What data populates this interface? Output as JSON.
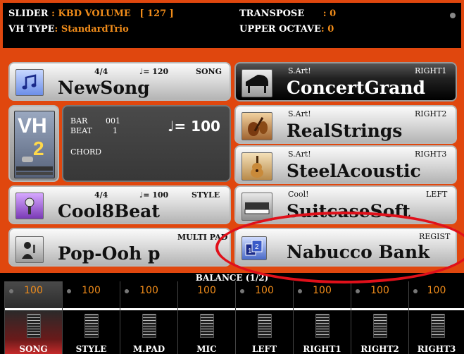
{
  "topbar": {
    "slider_label": "SLIDER",
    "slider_value": ": KBD VOLUME",
    "slider_bracket": "[    127    ]",
    "vh_type_label": "VH TYPE",
    "vh_type_value": ": StandardTrio",
    "transpose_label": "TRANSPOSE",
    "transpose_value": ": 0",
    "upper_octave_label": "UPPER OCTAVE",
    "upper_octave_value": ": 0"
  },
  "song": {
    "time_sig": "4/4",
    "tempo": "♩= 120",
    "type": "SONG",
    "name": "NewSong"
  },
  "vh_icon_text": "VH",
  "bar_beat": {
    "bar_label": "BAR",
    "bar_value": "001",
    "beat_label": "BEAT",
    "beat_value": "1",
    "chord_label": "CHORD",
    "tempo": "♩= 100"
  },
  "style": {
    "time_sig": "4/4",
    "tempo": "♩= 100",
    "type": "STYLE",
    "name": "Cool8Beat"
  },
  "multipad": {
    "type": "MULTI PAD",
    "name": "Pop-Ooh p"
  },
  "right_parts": [
    {
      "category": "S.Art!",
      "part": "RIGHT1",
      "name": "ConcertGrand"
    },
    {
      "category": "S.Art!",
      "part": "RIGHT2",
      "name": "RealStrings"
    },
    {
      "category": "S.Art!",
      "part": "RIGHT3",
      "name": "SteelAcoustic"
    },
    {
      "category": "Cool!",
      "part": "LEFT",
      "name": "SuitcaseSoft"
    }
  ],
  "regist": {
    "type": "REGIST",
    "name": "Nabucco Bank"
  },
  "balance": {
    "title": "BALANCE (1/2)",
    "channels": [
      {
        "label": "SONG",
        "value": "100"
      },
      {
        "label": "STYLE",
        "value": "100"
      },
      {
        "label": "M.PAD",
        "value": "100"
      },
      {
        "label": "MIC",
        "value": "100"
      },
      {
        "label": "LEFT",
        "value": "100"
      },
      {
        "label": "RIGHT1",
        "value": "100"
      },
      {
        "label": "RIGHT2",
        "value": "100"
      },
      {
        "label": "RIGHT3",
        "value": "100"
      }
    ]
  },
  "colors": {
    "frame": "#e0470e",
    "value_orange": "#f08c1a",
    "annotation_red": "#e0101a"
  }
}
